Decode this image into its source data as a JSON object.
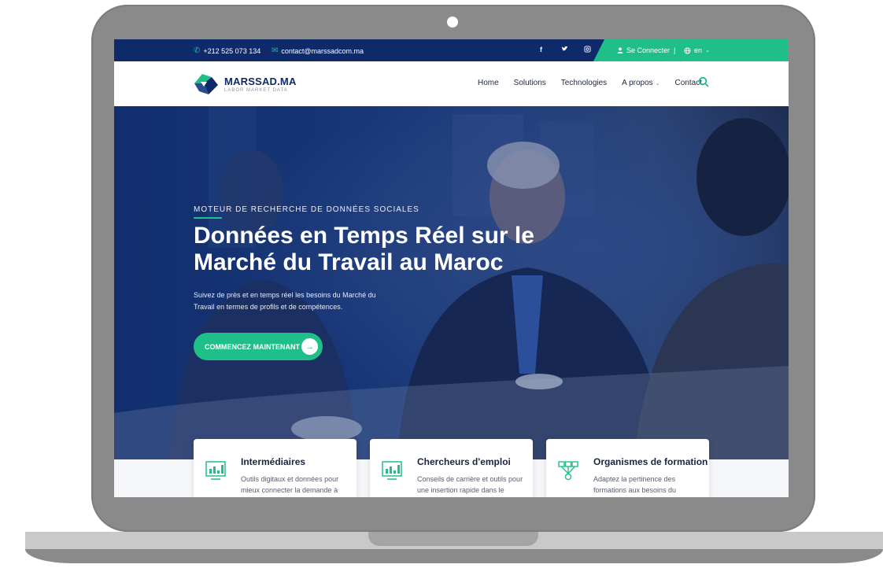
{
  "topbar": {
    "phone": "+212 525 073 134",
    "email": "contact@marssadcom.ma",
    "social": [
      "facebook-icon",
      "twitter-icon",
      "instagram-icon"
    ],
    "login": "Se Connecter",
    "separator": "|",
    "language": "en"
  },
  "logo": {
    "name_main": "MARSSAD",
    "name_suffix": ".MA",
    "tagline": "LABOR MARKET DATA"
  },
  "nav": {
    "items": [
      "Home",
      "Solutions",
      "Technologies",
      "A propos",
      "Contact"
    ]
  },
  "hero": {
    "kicker": "MOTEUR DE RECHERCHE DE DONNÉES SOCIALES",
    "title": "Données en Temps Réel sur le Marché du Travail au Maroc",
    "subtitle": "Suivez de près et en temps réel les besoins du Marché du Travail en termes de profils et de compétences.",
    "cta": "COMMENCEZ MAINTENANT"
  },
  "cards": [
    {
      "title": "Intermédiaires",
      "text": "Outils digitaux et données pour mieux connecter la demande à"
    },
    {
      "title": "Chercheurs d'emploi",
      "text": "Conseils de carrière et outils pour une insertion rapide dans le"
    },
    {
      "title": "Organismes de formation",
      "text": "Adaptez la pertinence des formations aux besoins du"
    }
  ],
  "colors": {
    "navy": "#0e2a6b",
    "green": "#20bf8a",
    "frame": "#8a8a8a"
  }
}
